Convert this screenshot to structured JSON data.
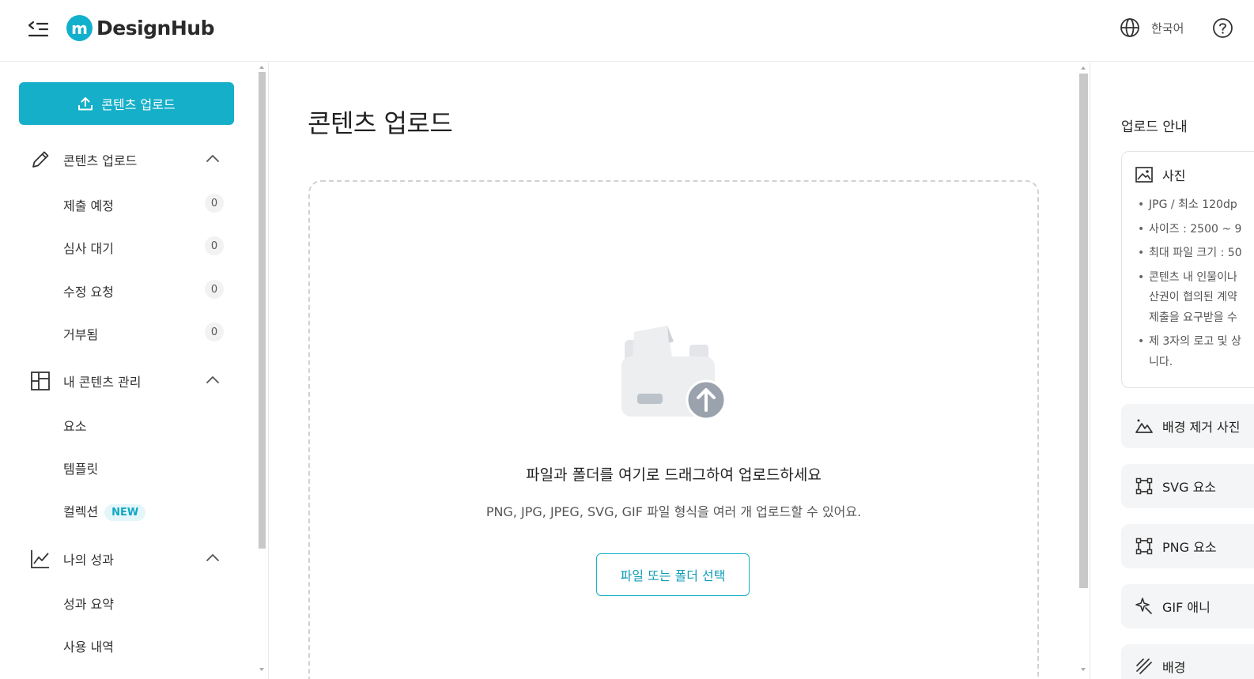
{
  "header": {
    "logo_mark": "m",
    "brand": "DesignHub",
    "language": "한국어"
  },
  "sidebar": {
    "upload_button": "콘텐츠 업로드",
    "sections": [
      {
        "label": "콘텐츠 업로드",
        "items": [
          {
            "label": "제출 예정",
            "count": "0"
          },
          {
            "label": "심사 대기",
            "count": "0"
          },
          {
            "label": "수정 요청",
            "count": "0"
          },
          {
            "label": "거부됨",
            "count": "0"
          }
        ]
      },
      {
        "label": "내 콘텐츠 관리",
        "items": [
          {
            "label": "요소"
          },
          {
            "label": "템플릿"
          },
          {
            "label": "컬렉션",
            "badge": "NEW"
          }
        ]
      },
      {
        "label": "나의 성과",
        "items": [
          {
            "label": "성과 요약"
          },
          {
            "label": "사용 내역"
          }
        ]
      }
    ]
  },
  "main": {
    "title": "콘텐츠 업로드",
    "dropzone": {
      "title": "파일과 폴더를 여기로 드래그하여 업로드하세요",
      "subtitle": "PNG, JPG, JPEG, SVG, GIF 파일 형식을 여러 개 업로드할 수 있어요.",
      "button": "파일 또는 폴더 선택"
    }
  },
  "guide": {
    "title": "업로드 안내",
    "photo": {
      "title": "사진",
      "bullets": [
        "JPG / 최소 120dp",
        "사이즈 : 2500 ~ 9",
        "최대 파일 크기 : 50",
        "콘텐츠 내 인물이나",
        "산권이 협의된 계약",
        "제출을 요구받을 수",
        "제 3자의 로고 및 상",
        "니다."
      ]
    },
    "types": [
      {
        "label": "배경 제거 사진",
        "icon": "mountain-icon"
      },
      {
        "label": "SVG 요소",
        "icon": "vector-frame-icon"
      },
      {
        "label": "PNG 요소",
        "icon": "vector-frame-icon"
      },
      {
        "label": "GIF 애니",
        "icon": "sparkle-icon"
      },
      {
        "label": "배경",
        "icon": "pattern-icon"
      }
    ]
  },
  "colors": {
    "accent": "#16afc9",
    "badge_bg": "#e3f6fa"
  }
}
